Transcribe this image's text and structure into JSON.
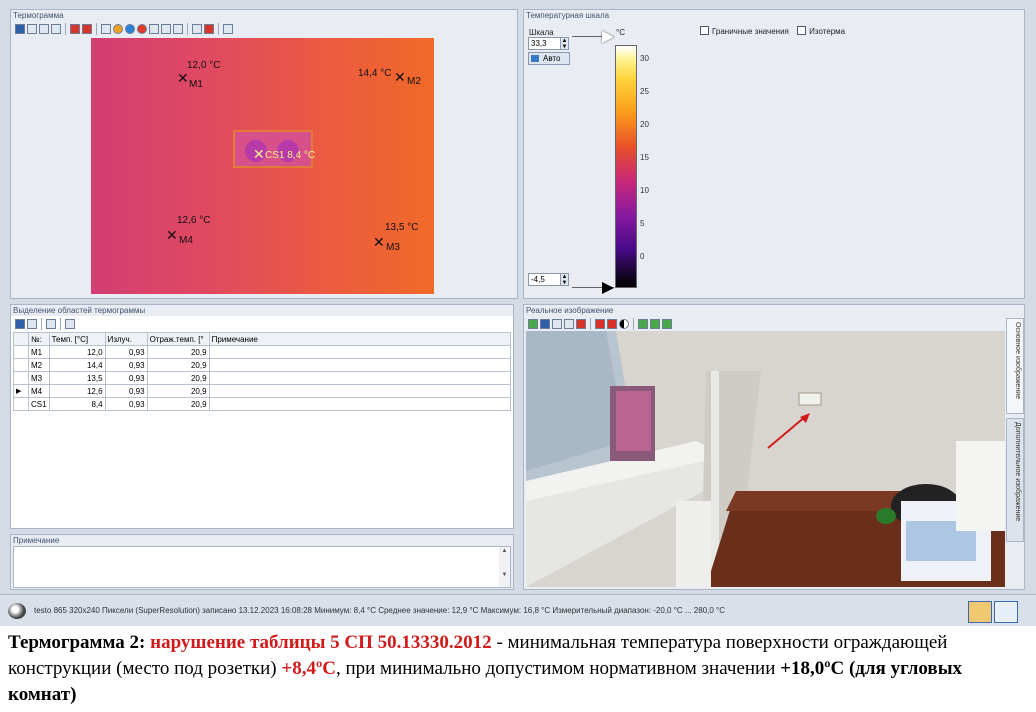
{
  "thermogram": {
    "title": "Термограмма",
    "markers": [
      {
        "id": "M1",
        "temp": "12,0 °C"
      },
      {
        "id": "M2",
        "temp": "14,4 °C"
      },
      {
        "id": "CS1",
        "label": "CS1 8,4 °C"
      },
      {
        "id": "M4",
        "temp": "12,6 °C"
      },
      {
        "id": "M3",
        "temp": "13,5 °C"
      }
    ]
  },
  "scale": {
    "title": "Температурная шкала",
    "shkala_label": "Шкала",
    "unit": "°C",
    "max_value": "33,3",
    "min_value": "-4,5",
    "auto_label": "Авто",
    "checkbox_limits": "Граничные значения",
    "checkbox_isotherm": "Изотерма",
    "ticks": [
      "30",
      "25",
      "20",
      "15",
      "10",
      "5",
      "0"
    ]
  },
  "regions": {
    "title": "Выделение областей термограммы",
    "columns": [
      "№:",
      "Темп. [°C]",
      "Излуч.",
      "Отраж.темп. [°",
      "Примечание"
    ],
    "rows": [
      [
        "M1",
        "12,0",
        "0,93",
        "20,9",
        ""
      ],
      [
        "M2",
        "14,4",
        "0,93",
        "20,9",
        ""
      ],
      [
        "M3",
        "13,5",
        "0,93",
        "20,9",
        ""
      ],
      [
        "M4",
        "12,6",
        "0,93",
        "20,9",
        ""
      ],
      [
        "CS1",
        "8,4",
        "0,93",
        "20,9",
        ""
      ]
    ]
  },
  "note": {
    "title": "Примечание"
  },
  "real_image": {
    "title": "Реальное изображение",
    "tab_main": "Основное изображение",
    "tab_extra": "Дополнительное изображение"
  },
  "status": {
    "text": "testo 865 320x240 Пиксели (SuperResolution) записано 13.12.2023 16:08:28 Минимум: 8,4 °C Среднее значение: 12,9 °C Максимум: 16,8 °C Измерительный диапазон: -20,0 °C ... 280,0 °C"
  },
  "caption": {
    "part1": "Термограмма  2: ",
    "part2": "нарушение таблицы 5 СП 50.13330.2012",
    "part3": " - минимальная температура поверхности ограждающей конструкции (место под розетки) ",
    "part4": "+8,4ºС",
    "part5": ", при минимально допустимом нормативном значении ",
    "part6": "+18,0ºС (для угловых комнат)"
  },
  "colors": {
    "accent_red": "#d21a1a",
    "panel_bg": "#e9edf3"
  }
}
